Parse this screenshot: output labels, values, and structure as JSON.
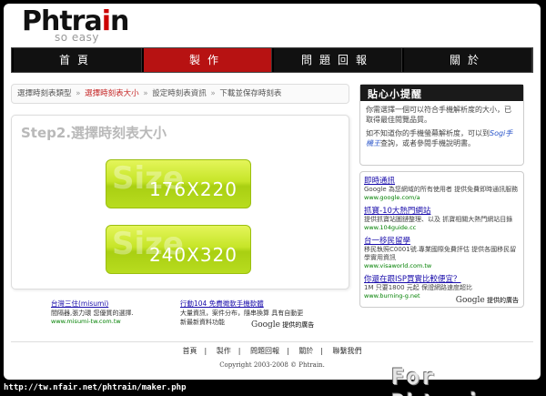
{
  "logo": {
    "brand_pre": "Phtra",
    "brand_i": "i",
    "brand_post": "n",
    "tagline": "so easy"
  },
  "nav": [
    {
      "label": "首頁"
    },
    {
      "label": "製作"
    },
    {
      "label": "問題回報"
    },
    {
      "label": "關於"
    }
  ],
  "breadcrumb": {
    "items": [
      "選擇時刻表類型",
      "選擇時刻表大小",
      "設定時刻表資訊",
      "下載並保存時刻表"
    ],
    "current_index": 1,
    "separator": "»"
  },
  "step": {
    "title": "Step2.選擇時刻表大小",
    "options": [
      {
        "bg_word": "Size",
        "dimensions": "176X220"
      },
      {
        "bg_word": "Size",
        "dimensions": "240X320"
      }
    ]
  },
  "bottom_ads": {
    "left": {
      "title": "台灣三住(misumi)",
      "desc": "間隔器,張力環 您優質的選擇.",
      "url": "www.misumi-tw.com.tw"
    },
    "right": {
      "title": "行動104 免費徵軟手機軟體",
      "desc": "大量資訊，案件分布，隨串換算 具有自動更新最新資料功能"
    },
    "badge": "提供的廣告",
    "badge_brand": "Google"
  },
  "tips": {
    "header": "貼心小提醒",
    "p1": "你需選擇一個可以符合手機解析度的大小，已取得最佳閱覽品質。",
    "p2_pre": "如不知道你的手機螢幕解析度，可以到",
    "p2_link": "Sogi手機王",
    "p2_post": "查詢，或者參閱手機說明書。"
  },
  "side_ads": [
    {
      "title": "即時通訊",
      "desc": "Google 為您網域的所有使用者 提供免費即時通訊服務",
      "url": "www.google.com/a"
    },
    {
      "title": "抓寶-10大熱門網站",
      "desc": "提供抓寶站圖鏈整理、以及 抓寶相關大熱門網站目錄",
      "url": "www.104guide.cc"
    },
    {
      "title": "台一移民留學",
      "desc": "移民執照C0001號.專業國際免費評估 提供各國移民留學實用資訊",
      "url": "www.visaworld.com.tw"
    },
    {
      "title": "你還在跟ISP買實比較便宜？",
      "desc": "1M 只要1800 元起 保證網路速度超比",
      "url": "www.burning-g.net"
    }
  ],
  "side_badge": "提供的廣告",
  "side_badge_brand": "Google",
  "footer": {
    "links": [
      "首頁",
      "製作",
      "問題回報",
      "關於",
      "聯繫我們"
    ],
    "sep": "|",
    "copyright": "Copyright 2003-2008 © Phtrain."
  },
  "url_text": "http://tw.nfair.net/phtrain/maker.php",
  "watermark": "For Phtrain",
  "colors": {
    "active_nav": "#b71212",
    "button_green": "#c6e528",
    "crumb_current": "#c62828"
  }
}
